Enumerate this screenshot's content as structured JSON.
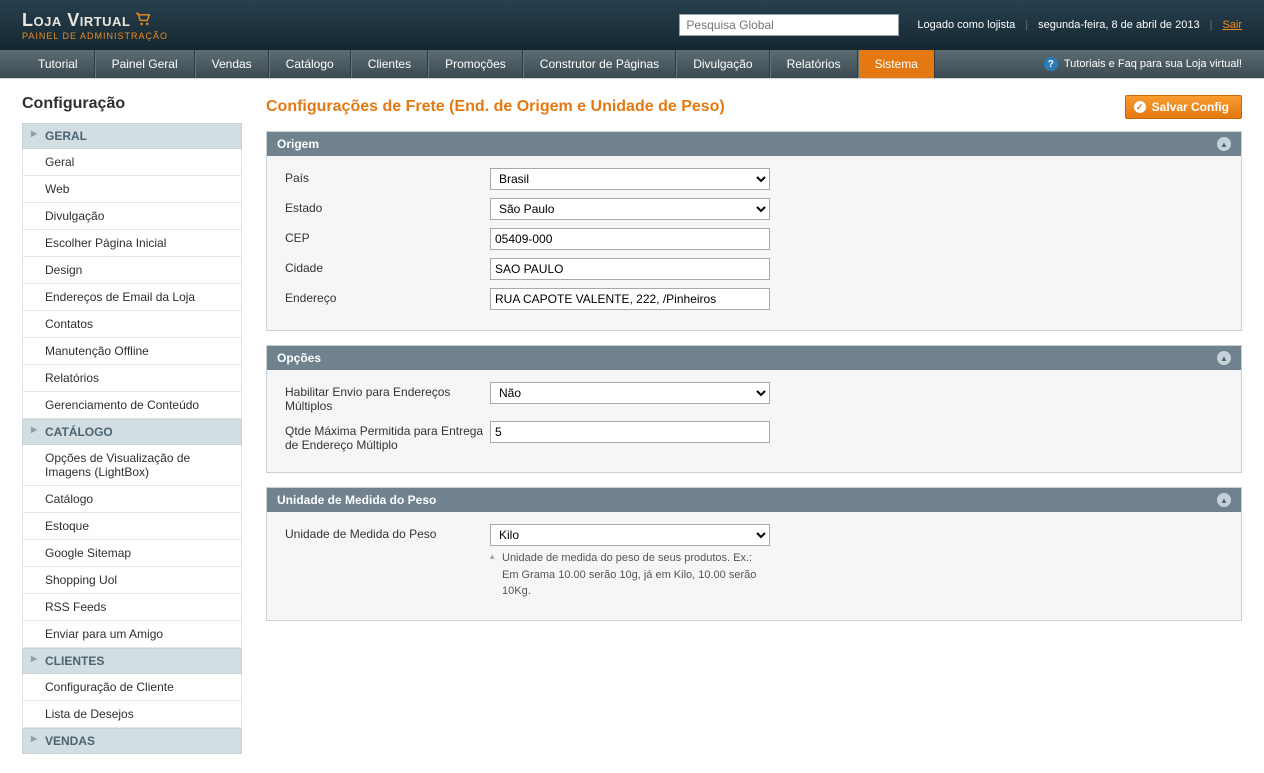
{
  "header": {
    "logo_main": "Loja Virtual",
    "logo_sub": "Painel de Administração",
    "search_placeholder": "Pesquisa Global",
    "login_text": "Logado como lojista",
    "date_text": "segunda-feira, 8 de abril de 2013",
    "logout": "Sair"
  },
  "nav": {
    "items": [
      "Tutorial",
      "Painel Geral",
      "Vendas",
      "Catálogo",
      "Clientes",
      "Promoções",
      "Construtor de Páginas",
      "Divulgação",
      "Relatórios",
      "Sistema"
    ],
    "active_index": 9,
    "help_text": "Tutoriais e Faq para sua Loja virtual!"
  },
  "sidebar": {
    "title": "Configuração",
    "groups": [
      {
        "head": "GERAL",
        "items": [
          "Geral",
          "Web",
          "Divulgação",
          "Escolher Página Inicial",
          "Design",
          "Endereços de Email da Loja",
          "Contatos",
          "Manutenção Offline",
          "Relatórios",
          "Gerenciamento de Conteúdo"
        ]
      },
      {
        "head": "CATÁLOGO",
        "items": [
          "Opções de Visualização de Imagens (LightBox)",
          "Catálogo",
          "Estoque",
          "Google Sitemap",
          "Shopping Uol",
          "RSS Feeds",
          "Enviar para um Amigo"
        ]
      },
      {
        "head": "CLIENTES",
        "items": [
          "Configuração de Cliente",
          "Lista de Desejos"
        ]
      },
      {
        "head": "VENDAS",
        "items": []
      }
    ]
  },
  "page": {
    "title": "Configurações de Frete (End. de Origem e Unidade de Peso)",
    "save_label": "Salvar Config"
  },
  "panels": {
    "origin": {
      "title": "Origem",
      "country_label": "País",
      "country_value": "Brasil",
      "state_label": "Estado",
      "state_value": "São Paulo",
      "cep_label": "CEP",
      "cep_value": "05409-000",
      "city_label": "Cidade",
      "city_value": "SAO PAULO",
      "address_label": "Endereço",
      "address_value": "RUA CAPOTE VALENTE, 222, /Pinheiros"
    },
    "options": {
      "title": "Opções",
      "multi_label": "Habilitar Envio para Endereços Múltiplos",
      "multi_value": "Não",
      "maxqty_label": "Qtde Máxima Permitida para Entrega de Endereço Múltiplo",
      "maxqty_value": "5"
    },
    "weight": {
      "title": "Unidade de Medida do Peso",
      "unit_label": "Unidade de Medida do Peso",
      "unit_value": "Kilo",
      "hint": "Unidade de medida do peso de seus produtos. Ex.: Em Grama 10.00 serão 10g, já em Kilo, 10.00 serão 10Kg."
    }
  }
}
